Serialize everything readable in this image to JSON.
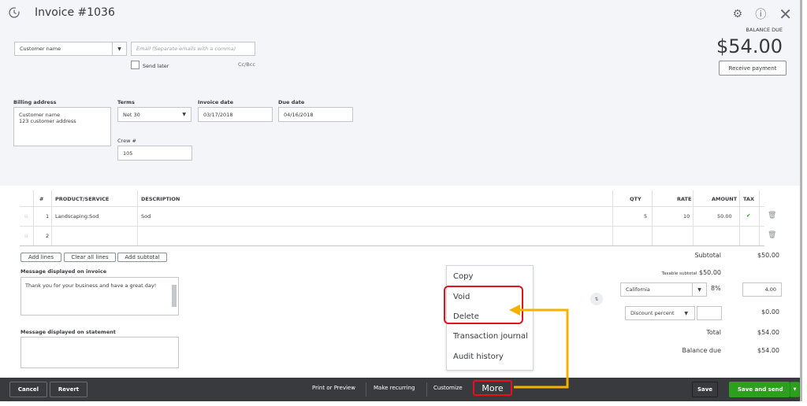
{
  "header": {
    "title": "Invoice #1036",
    "balance_due_label": "BALANCE DUE",
    "balance_due": "$54.00",
    "receive_payment": "Receive payment"
  },
  "customer": {
    "name_value": "Customer name",
    "email_placeholder": "Email (Separate emails with a comma)",
    "send_later": "Send later",
    "cc_bcc": "Cc/Bcc"
  },
  "fields": {
    "billing_label": "Billing address",
    "billing_line1": "Customer name",
    "billing_line2": "123 customer address",
    "terms_label": "Terms",
    "terms_value": "Net 30",
    "invoice_date_label": "Invoice date",
    "invoice_date": "03/17/2018",
    "due_date_label": "Due date",
    "due_date": "04/16/2018",
    "crew_label": "Crew #",
    "crew_value": "105"
  },
  "table": {
    "headers": [
      "#",
      "PRODUCT/SERVICE",
      "DESCRIPTION",
      "QTY",
      "RATE",
      "AMOUNT",
      "TAX"
    ],
    "rows": [
      {
        "num": "1",
        "product": "Landscaping:Sod",
        "description": "Sod",
        "qty": "5",
        "rate": "10",
        "amount": "50.00",
        "tax": "✔"
      },
      {
        "num": "2",
        "product": "",
        "description": "",
        "qty": "",
        "rate": "",
        "amount": "",
        "tax": ""
      }
    ],
    "add_lines": "Add lines",
    "clear_all_lines": "Clear all lines",
    "add_subtotal": "Add subtotal"
  },
  "messages": {
    "invoice_label": "Message displayed on invoice",
    "invoice_value": "Thank you for your business and have a great day!",
    "statement_label": "Message displayed on statement",
    "statement_value": ""
  },
  "totals": {
    "subtotal_label": "Subtotal",
    "subtotal": "$50.00",
    "taxable_label": "Taxable subtotal",
    "taxable": "$50.00",
    "tax_region": "California",
    "tax_rate": "8%",
    "tax_amount": "4.00",
    "discount_type": "Discount percent",
    "discount_amount": "$0.00",
    "total_label": "Total",
    "total": "$54.00",
    "balance_label": "Balance due",
    "balance": "$54.00"
  },
  "menu": {
    "items": [
      "Copy",
      "Void",
      "Delete",
      "Transaction journal",
      "Audit history"
    ]
  },
  "footer": {
    "cancel": "Cancel",
    "revert": "Revert",
    "print_preview": "Print or Preview",
    "make_recurring": "Make recurring",
    "customize": "Customize",
    "more": "More",
    "save": "Save",
    "save_and_send": "Save and send"
  },
  "colors": {
    "highlight": "#e8101a",
    "arrow": "#f5b300",
    "primary_green": "#2ca01c",
    "footer_bg": "#393a3d"
  }
}
